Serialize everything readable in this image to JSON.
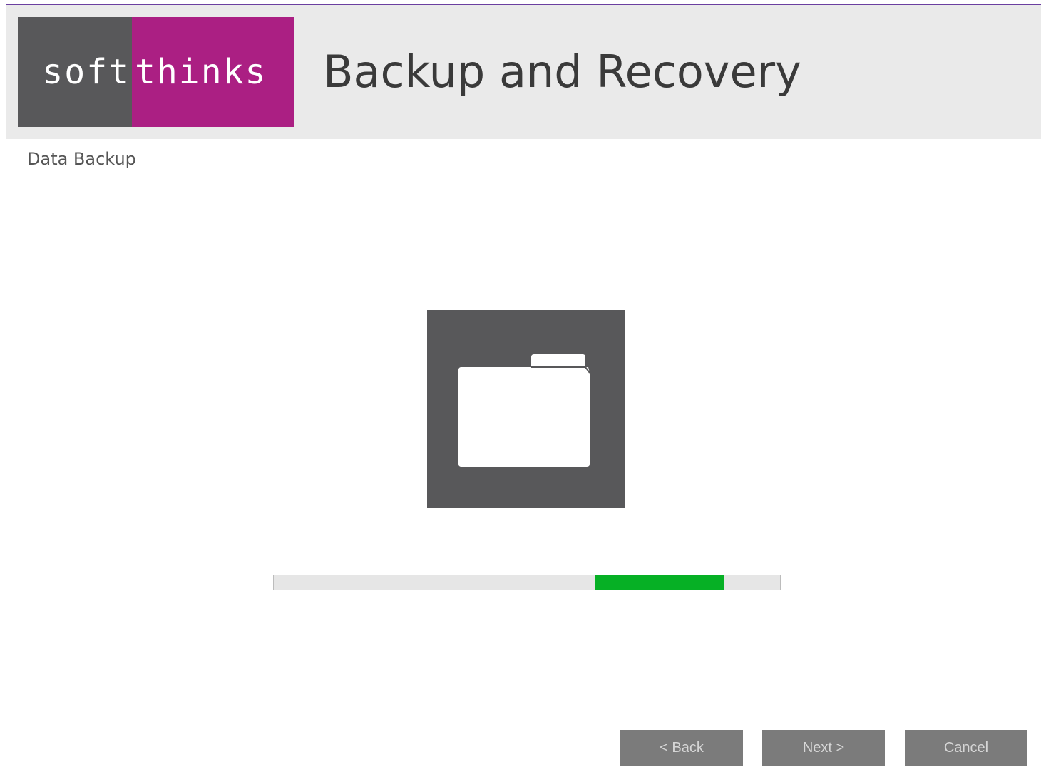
{
  "header": {
    "logo_left": "soft",
    "logo_right": "thinks",
    "title": "Backup and Recovery"
  },
  "page": {
    "title": "Data Backup",
    "icon": "folder-icon"
  },
  "progress": {
    "mode": "indeterminate-marquee"
  },
  "buttons": {
    "back": "< Back",
    "next": "Next >",
    "cancel": "Cancel"
  },
  "colors": {
    "brand_gray": "#58585a",
    "brand_magenta": "#ab1f83",
    "progress_green": "#06b025",
    "button_gray": "#7b7b7b"
  }
}
